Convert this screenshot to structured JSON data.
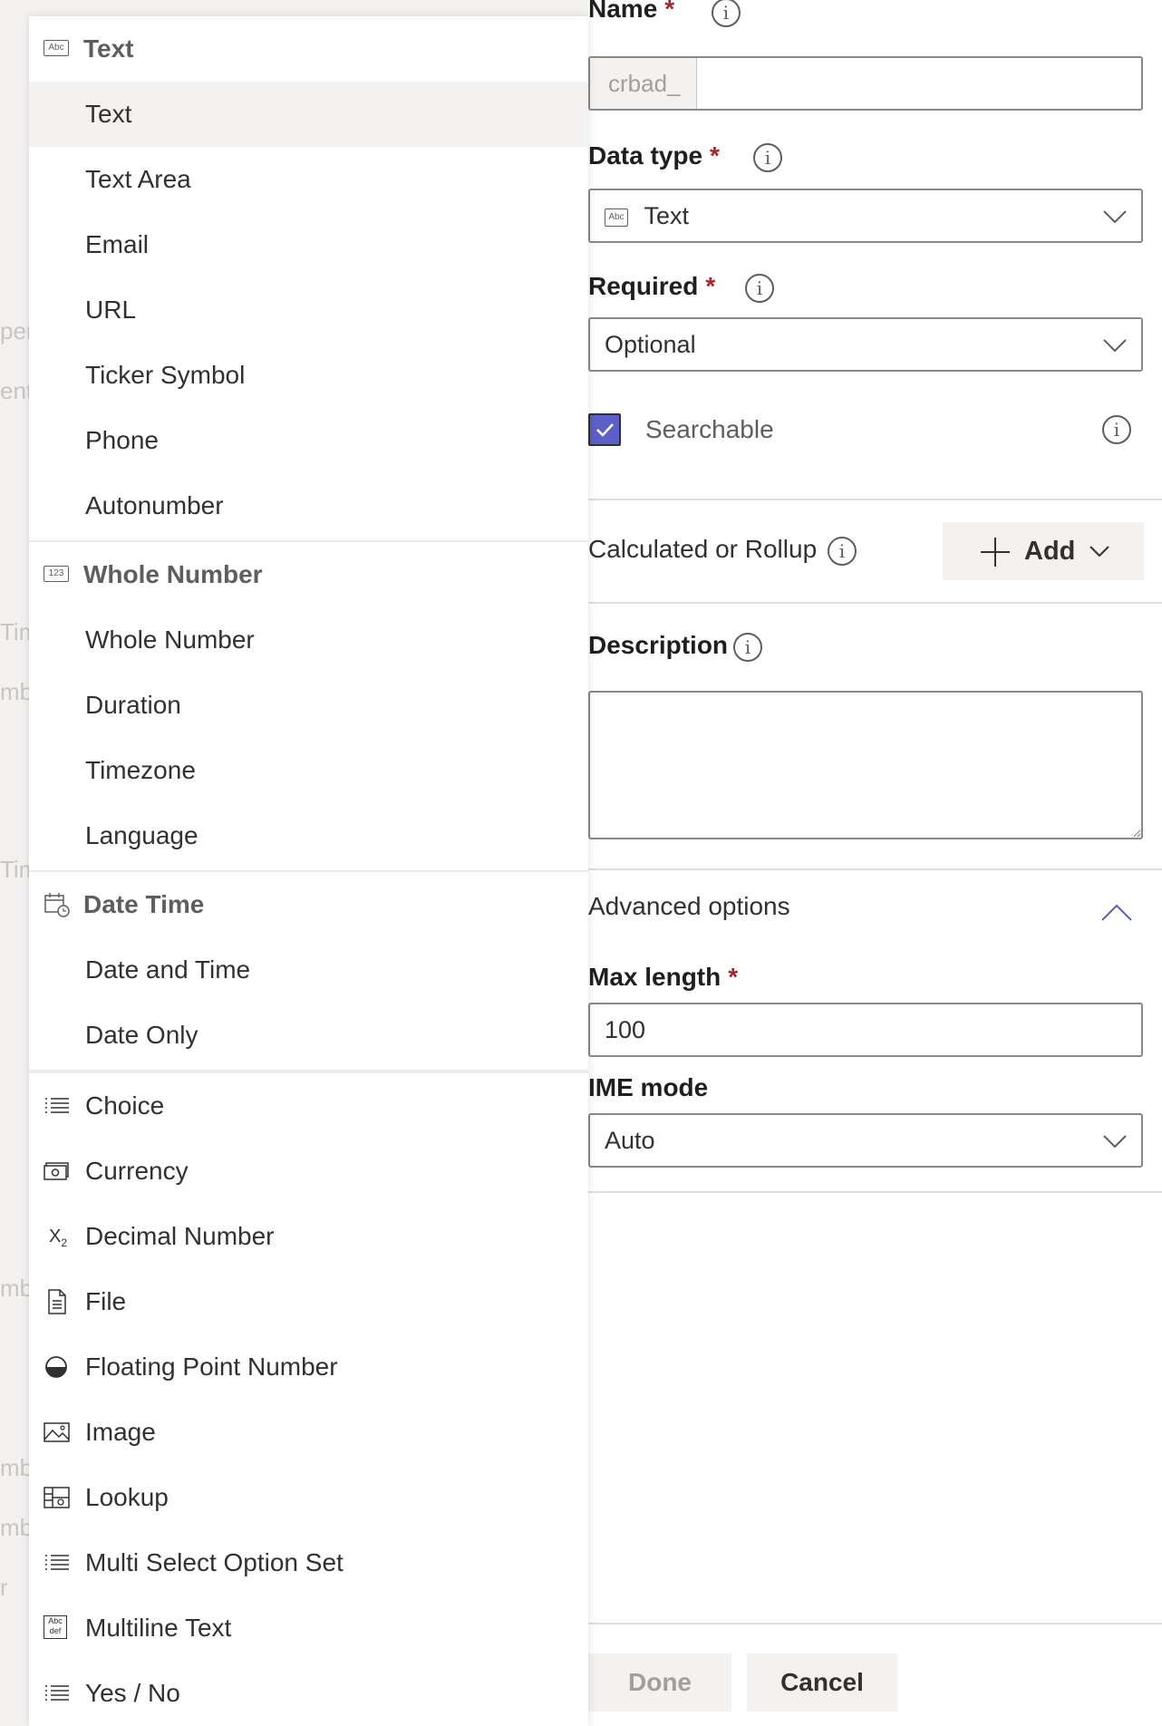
{
  "background_fragments": [
    "pen",
    "ent",
    "Tim",
    "mb",
    "Tim",
    "mb",
    "mb",
    "mb",
    "r"
  ],
  "form": {
    "name": {
      "label": "Name",
      "required_mark": "*",
      "prefix": "crbad_",
      "value": ""
    },
    "data_type": {
      "label": "Data type",
      "required_mark": "*",
      "value": "Text",
      "icon": "abc-icon"
    },
    "required": {
      "label": "Required",
      "required_mark": "*",
      "value": "Optional"
    },
    "searchable": {
      "label": "Searchable",
      "checked": true
    },
    "calculated": {
      "label": "Calculated or Rollup",
      "add_label": "Add"
    },
    "description": {
      "label": "Description",
      "value": ""
    },
    "advanced": {
      "label": "Advanced options"
    },
    "max_length": {
      "label": "Max length",
      "required_mark": "*",
      "value": "100"
    },
    "ime_mode": {
      "label": "IME mode",
      "value": "Auto"
    }
  },
  "footer": {
    "done_label": "Done",
    "cancel_label": "Cancel"
  },
  "menu": {
    "text_group": "Text",
    "text_items": [
      "Text",
      "Text Area",
      "Email",
      "URL",
      "Ticker Symbol",
      "Phone",
      "Autonumber"
    ],
    "number_group": "Whole Number",
    "number_items": [
      "Whole Number",
      "Duration",
      "Timezone",
      "Language"
    ],
    "date_group": "Date Time",
    "date_items": [
      "Date and Time",
      "Date Only"
    ],
    "other_items": [
      {
        "label": "Choice",
        "icon": "list-icon"
      },
      {
        "label": "Currency",
        "icon": "currency-icon"
      },
      {
        "label": "Decimal Number",
        "icon": "subscript-x-icon"
      },
      {
        "label": "File",
        "icon": "document-icon"
      },
      {
        "label": "Floating Point Number",
        "icon": "half-circle-icon"
      },
      {
        "label": "Image",
        "icon": "image-icon"
      },
      {
        "label": "Lookup",
        "icon": "lookup-icon"
      },
      {
        "label": "Multi Select Option Set",
        "icon": "list-icon"
      },
      {
        "label": "Multiline Text",
        "icon": "multiline-text-icon"
      },
      {
        "label": "Yes / No",
        "icon": "list-icon"
      }
    ],
    "selected": "Text"
  }
}
